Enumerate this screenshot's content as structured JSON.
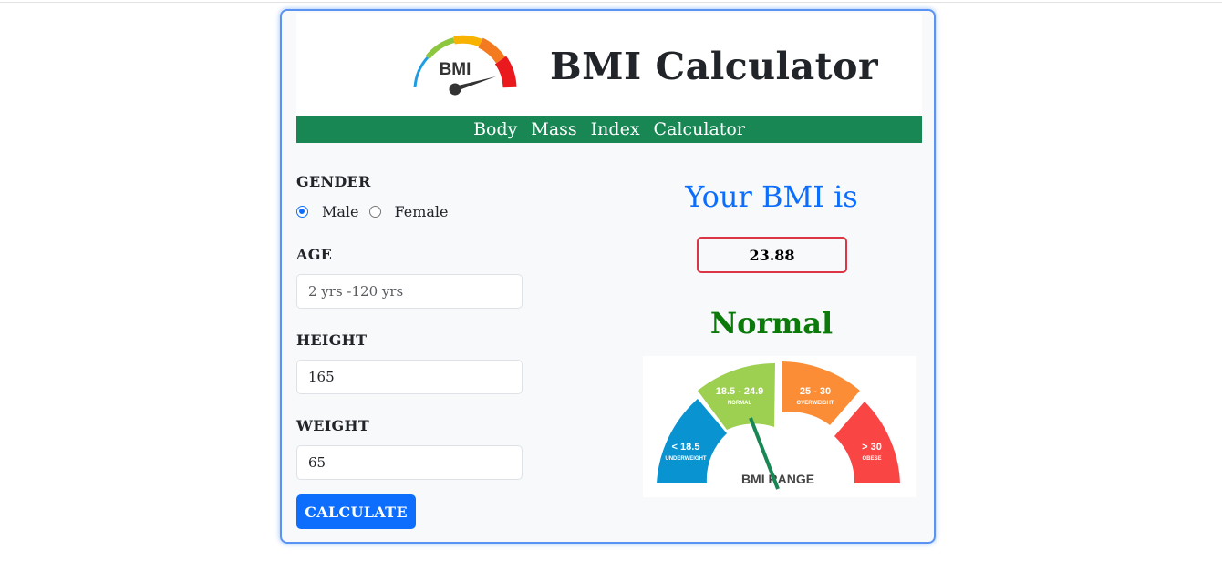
{
  "header": {
    "logo_text": "BMI",
    "title": "BMI Calculator",
    "subtitle_words": [
      "Body",
      "Mass",
      "Index",
      "Calculator"
    ]
  },
  "form": {
    "gender": {
      "label": "GENDER",
      "options": [
        {
          "label": "Male",
          "checked": true
        },
        {
          "label": "Female",
          "checked": false
        }
      ]
    },
    "age": {
      "label": "AGE",
      "value": "",
      "placeholder": "2 yrs -120 yrs"
    },
    "height": {
      "label": "HEIGHT",
      "value": "165"
    },
    "weight": {
      "label": "WEIGHT",
      "value": "65"
    },
    "calculate_label": "CALCULATE"
  },
  "result": {
    "heading": "Your BMI is",
    "value": "23.88",
    "category": "Normal"
  },
  "gauge": {
    "title": "BMI RANGE",
    "segments": [
      {
        "range": "< 18.5",
        "name": "UNDERWEIGHT",
        "color": "#0a93d1"
      },
      {
        "range": "18.5 - 24.9",
        "name": "NORMAL",
        "color": "#9dcf51"
      },
      {
        "range": "25 - 30",
        "name": "OVERWEIGHT",
        "color": "#fb8d37"
      },
      {
        "range": "> 30",
        "name": "OBESE",
        "color": "#f94645"
      }
    ],
    "needle_color": "#198754"
  },
  "colors": {
    "accent": "#0d6efd",
    "header_bar": "#198754",
    "normal_text": "#0b7a0b",
    "result_border": "#dc3545"
  }
}
